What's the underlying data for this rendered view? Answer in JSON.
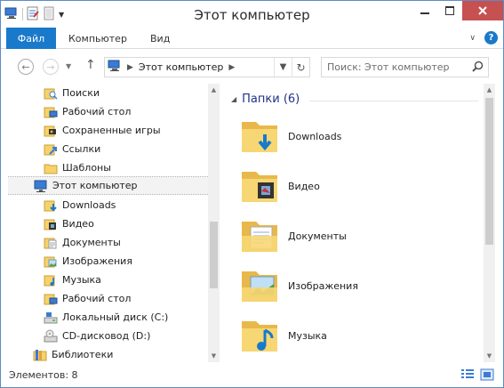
{
  "window": {
    "title": "Этот компьютер"
  },
  "ribbon": {
    "file_tab": "Файл",
    "tabs": [
      "Компьютер",
      "Вид"
    ],
    "help": "?"
  },
  "address": {
    "segment": "Этот компьютер"
  },
  "search": {
    "placeholder": "Поиск: Этот компьютер"
  },
  "nav": {
    "items": [
      {
        "label": "Поиски",
        "icon": "search-folder-icon"
      },
      {
        "label": "Рабочий стол",
        "icon": "desktop-folder-icon"
      },
      {
        "label": "Сохраненные игры",
        "icon": "saved-games-icon"
      },
      {
        "label": "Ссылки",
        "icon": "links-folder-icon"
      },
      {
        "label": "Шаблоны",
        "icon": "folder-icon"
      },
      {
        "label": "Этот компьютер",
        "icon": "computer-icon",
        "selected": true
      },
      {
        "label": "Downloads",
        "icon": "downloads-folder-icon"
      },
      {
        "label": "Видео",
        "icon": "videos-folder-icon"
      },
      {
        "label": "Документы",
        "icon": "documents-folder-icon"
      },
      {
        "label": "Изображения",
        "icon": "pictures-folder-icon"
      },
      {
        "label": "Музыка",
        "icon": "music-folder-icon"
      },
      {
        "label": "Рабочий стол",
        "icon": "desktop-folder-icon"
      },
      {
        "label": "Локальный диск (C:)",
        "icon": "local-disk-icon"
      },
      {
        "label": "CD-дисковод (D:)",
        "icon": "cd-drive-icon"
      },
      {
        "label": "Библиотеки",
        "icon": "libraries-icon"
      }
    ]
  },
  "content": {
    "group_title": "Папки (6)",
    "folders": [
      {
        "label": "Downloads",
        "icon": "downloads-folder-icon"
      },
      {
        "label": "Видео",
        "icon": "videos-folder-icon"
      },
      {
        "label": "Документы",
        "icon": "documents-folder-icon"
      },
      {
        "label": "Изображения",
        "icon": "pictures-folder-icon"
      },
      {
        "label": "Музыка",
        "icon": "music-folder-icon"
      }
    ]
  },
  "status": {
    "text": "Элементов: 8"
  },
  "colors": {
    "accent": "#1979ca",
    "close": "#c75050",
    "group_header": "#1e3287",
    "folder": "#f5d26b"
  }
}
